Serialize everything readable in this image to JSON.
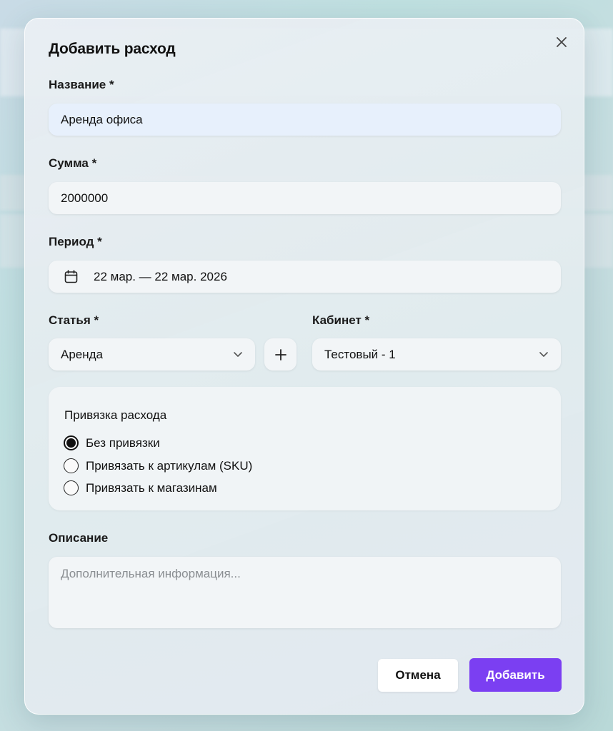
{
  "dialog": {
    "title": "Добавить расход",
    "close_icon": "close-icon"
  },
  "form": {
    "name": {
      "label": "Название *",
      "value": "Аренда офиса"
    },
    "amount": {
      "label": "Сумма *",
      "value": "2000000"
    },
    "period": {
      "label": "Период *",
      "value": "22 мар. — 22 мар. 2026",
      "icon": "calendar-icon"
    },
    "category": {
      "label": "Статья *",
      "value": "Аренда",
      "icon": "chevron-down-icon",
      "add_icon": "plus-icon"
    },
    "cabinet": {
      "label": "Кабинет *",
      "value": "Тестовый - 1",
      "icon": "chevron-down-icon"
    },
    "binding": {
      "title": "Привязка расхода",
      "options": [
        {
          "label": "Без привязки",
          "checked": true
        },
        {
          "label": "Привязать к артикулам (SKU)",
          "checked": false
        },
        {
          "label": "Привязать к магазинам",
          "checked": false
        }
      ]
    },
    "description": {
      "label": "Описание",
      "placeholder": "Дополнительная информация..."
    }
  },
  "actions": {
    "cancel_label": "Отмена",
    "submit_label": "Добавить"
  },
  "colors": {
    "accent": "#7b3ff2",
    "focused_field": "#e7f0fc"
  }
}
